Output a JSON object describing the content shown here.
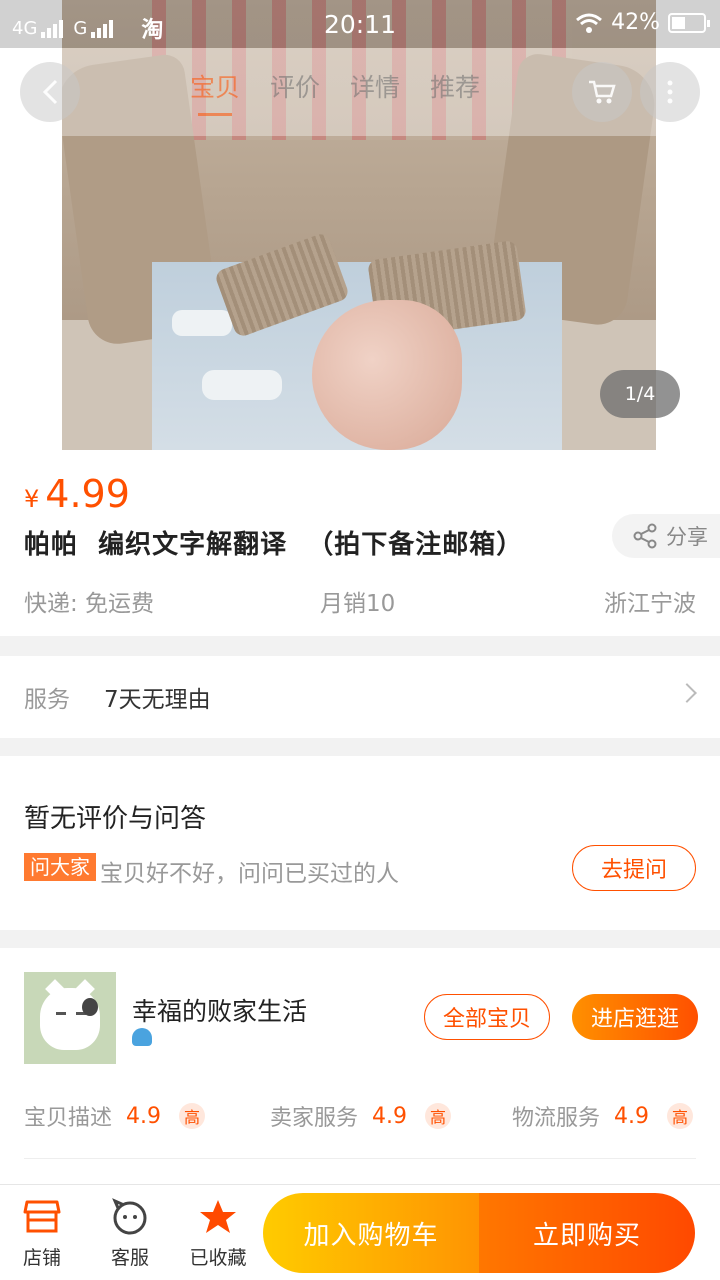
{
  "status_bar": {
    "network_1": "4G",
    "network_2": "G",
    "app_badge": "淘",
    "time": "20:11",
    "battery_percent": "42%",
    "battery_level": 0.42
  },
  "top_nav": {
    "tabs": [
      "宝贝",
      "评价",
      "详情",
      "推荐"
    ],
    "active_tab": 0
  },
  "gallery": {
    "counter": "1/4"
  },
  "product": {
    "currency": "¥",
    "price": "4.99",
    "title": "帕帕  编织文字解翻译  （拍下备注邮箱）",
    "share_label": "分享",
    "shipping": "快递: 免运费",
    "monthly_sales": "月销10",
    "location": "浙江宁波"
  },
  "service": {
    "label": "服务",
    "value": "7天无理由"
  },
  "reviews": {
    "heading": "暂无评价与问答",
    "ask_tag": "问大家",
    "ask_text": "宝贝好不好，问问已买过的人",
    "ask_button": "去提问"
  },
  "shop": {
    "name": "幸福的败家生活",
    "all_items_button": "全部宝贝",
    "enter_shop_button": "进店逛逛",
    "ratings": [
      {
        "label": "宝贝描述",
        "score": "4.9",
        "tag": "高"
      },
      {
        "label": "卖家服务",
        "score": "4.9",
        "tag": "高"
      },
      {
        "label": "物流服务",
        "score": "4.9",
        "tag": "高"
      }
    ]
  },
  "bottom_bar": {
    "store": "店铺",
    "service": "客服",
    "favorited": "已收藏",
    "add_to_cart": "加入购物车",
    "buy_now": "立即购买"
  },
  "colors": {
    "accent": "#ff5000",
    "cart_gradient": [
      "#ffcb00",
      "#ff9402"
    ],
    "buy_gradient": [
      "#ff7700",
      "#ff4900"
    ]
  }
}
